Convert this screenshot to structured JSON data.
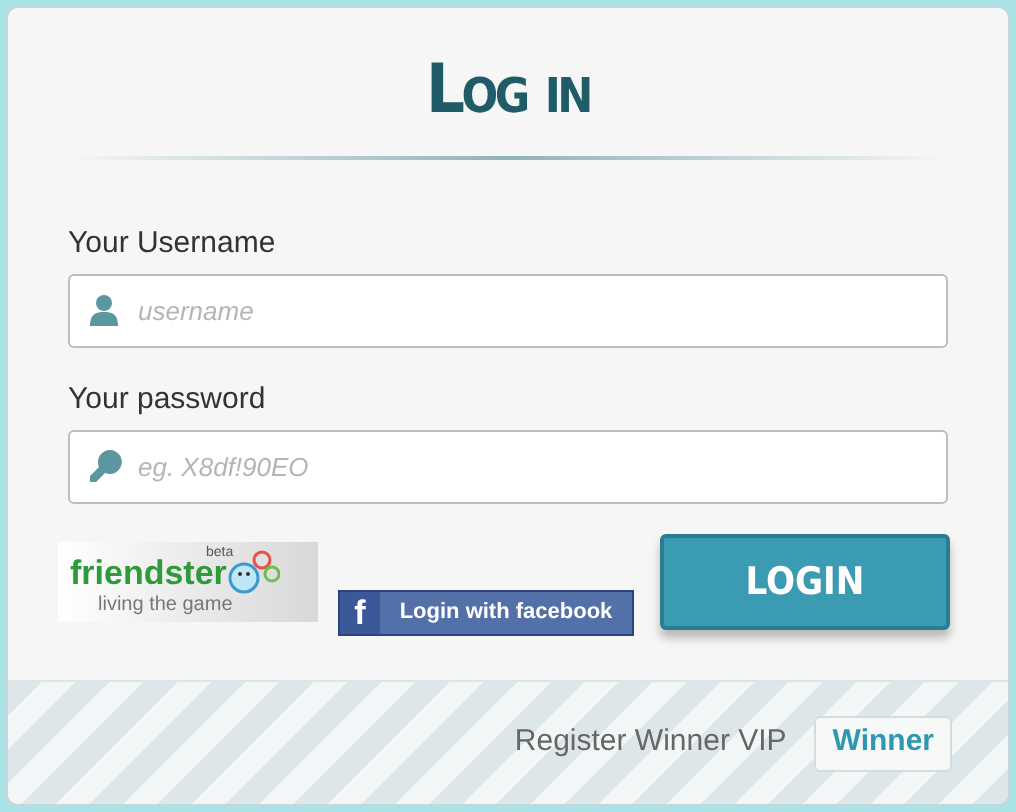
{
  "title": "Log in",
  "fields": [
    {
      "label": "Your Username",
      "placeholder": "username",
      "kind": "user"
    },
    {
      "label": "Your password",
      "placeholder": "eg. X8df!90EO",
      "kind": "key"
    }
  ],
  "friendster_logo": {
    "name": "friendster",
    "badge": "beta",
    "tagline": "living the game"
  },
  "facebook_button": {
    "icon": "f",
    "label": "Login with facebook"
  },
  "login_button": "LOGIN",
  "footer": {
    "text": "Register Winner VIP",
    "button": "Winner"
  }
}
